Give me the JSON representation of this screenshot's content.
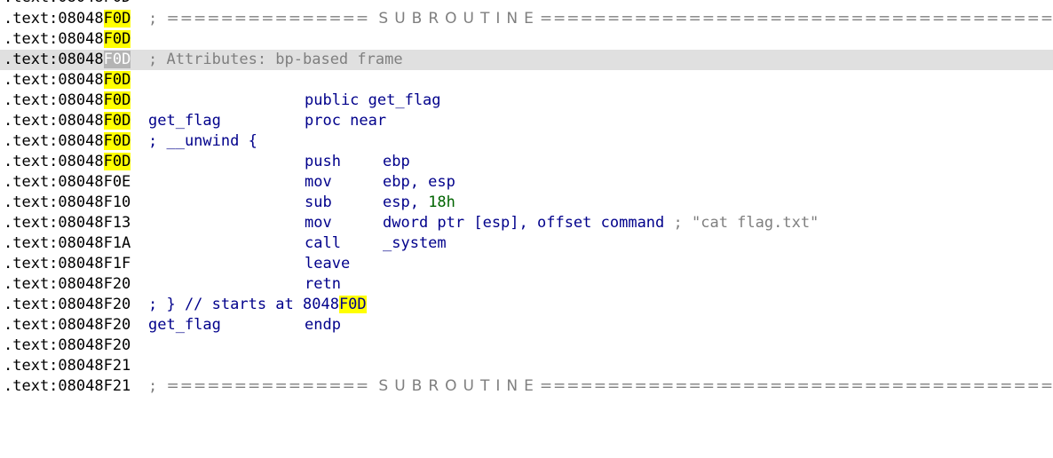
{
  "colors": {
    "background": "#ffffff",
    "address_highlight": "#ffff00",
    "selected_line": "#e0e0e0",
    "comment": "#7f7f7f",
    "code": "#00008b",
    "number": "#006400"
  },
  "listing": {
    "lines": [
      {
        "seg": ".text:08048",
        "hl": "F0D",
        "text": ".text:08048F0D"
      },
      {
        "seg": ".text:08048",
        "hl": "F0D"
      },
      {
        "seg": ".text:08048",
        "hl": "F0D"
      },
      {
        "seg": ".text:08048",
        "hl": "F0D"
      },
      {
        "seg": ".text:08048",
        "hl": "F0D"
      },
      {
        "seg": ".text:08048",
        "hl": "F0D"
      },
      {
        "seg": ".text:08048",
        "hl": "F0D"
      },
      {
        "seg": ".text:08048",
        "hl": "F0D"
      },
      {
        "seg": ".text:08048",
        "hl": "F0D"
      },
      {
        "addr": ".text:08048F0E"
      },
      {
        "addr": ".text:08048F10"
      },
      {
        "addr": ".text:08048F13"
      },
      {
        "addr": ".text:08048F1A"
      },
      {
        "addr": ".text:08048F1F"
      },
      {
        "addr": ".text:08048F20"
      },
      {
        "addr": ".text:08048F20"
      },
      {
        "addr": ".text:08048F20"
      },
      {
        "addr": ".text:08048F20"
      },
      {
        "addr": ".text:08048F21"
      },
      {
        "addr": ".text:08048F21"
      }
    ],
    "top_partial": ".text:08048F0D",
    "banner_semicolon": ";",
    "banner_left": "===============",
    "banner_word": "SUBROUTINE",
    "banner_right": "=======================================",
    "attributes_comment": "; Attributes: bp-based frame",
    "public_directive": "public get_flag",
    "proc_label": "get_flag",
    "proc_directive": "proc near",
    "unwind_comment": "; __unwind {",
    "instructions": [
      {
        "mnemonic": "push",
        "operand": "ebp"
      },
      {
        "mnemonic": "mov",
        "operand": "ebp, esp"
      },
      {
        "mnemonic": "sub",
        "operand_reg": "esp, ",
        "operand_num": "18h"
      },
      {
        "mnemonic": "mov",
        "operand": "dword ptr [esp], offset command",
        "comment": "; \"cat flag.txt\""
      },
      {
        "mnemonic": "call",
        "operand": "_system"
      },
      {
        "mnemonic": "leave"
      },
      {
        "mnemonic": "retn"
      }
    ],
    "end_comment_prefix": "; } // starts at 8048",
    "end_comment_hl": "F0D",
    "endp_label": "get_flag",
    "endp_directive": "endp"
  }
}
